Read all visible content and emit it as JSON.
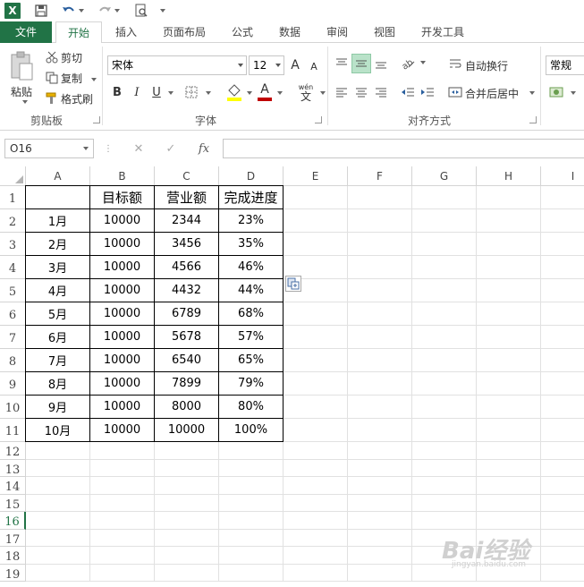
{
  "qat": {
    "undo_icon": "undo-icon",
    "redo_icon": "redo-icon"
  },
  "tabs": [
    "文件",
    "开始",
    "插入",
    "页面布局",
    "公式",
    "数据",
    "审阅",
    "视图",
    "开发工具"
  ],
  "ribbon": {
    "clipboard": {
      "paste": "粘贴",
      "cut": "剪切",
      "copy": "复制",
      "format_painter": "格式刷",
      "label": "剪贴板"
    },
    "font": {
      "font_name": "宋体",
      "font_size": "12",
      "bold": "B",
      "italic": "I",
      "underline": "U",
      "grow": "A",
      "shrink": "A",
      "font_color_glyph": "A",
      "phonetic": "wén",
      "phonetic_char": "文",
      "label": "字体"
    },
    "alignment": {
      "wrap_text": "自动换行",
      "merge_center": "合并后居中",
      "label": "对齐方式"
    },
    "number": {
      "format": "常规"
    }
  },
  "formula_bar": {
    "name_box": "O16",
    "fx": "fx",
    "cancel": "✕",
    "confirm": "✓"
  },
  "sheet": {
    "columns": [
      "A",
      "B",
      "C",
      "D",
      "E",
      "F",
      "G",
      "H",
      "I"
    ],
    "rows": [
      "1",
      "2",
      "3",
      "4",
      "5",
      "6",
      "7",
      "8",
      "9",
      "10",
      "11",
      "12",
      "13",
      "14",
      "15",
      "16",
      "17",
      "18",
      "19"
    ],
    "active_row": "16",
    "headers": [
      "",
      "目标额",
      "营业额",
      "完成进度"
    ],
    "data": [
      [
        "1月",
        "10000",
        "2344",
        "23%"
      ],
      [
        "2月",
        "10000",
        "3456",
        "35%"
      ],
      [
        "3月",
        "10000",
        "4566",
        "46%"
      ],
      [
        "4月",
        "10000",
        "4432",
        "44%"
      ],
      [
        "5月",
        "10000",
        "6789",
        "68%"
      ],
      [
        "6月",
        "10000",
        "5678",
        "57%"
      ],
      [
        "7月",
        "10000",
        "6540",
        "65%"
      ],
      [
        "8月",
        "10000",
        "7899",
        "79%"
      ],
      [
        "9月",
        "10000",
        "8000",
        "80%"
      ],
      [
        "10月",
        "10000",
        "10000",
        "100%"
      ]
    ]
  },
  "watermark": {
    "text": "Bai经验",
    "url": "jingyan.baidu.com"
  }
}
